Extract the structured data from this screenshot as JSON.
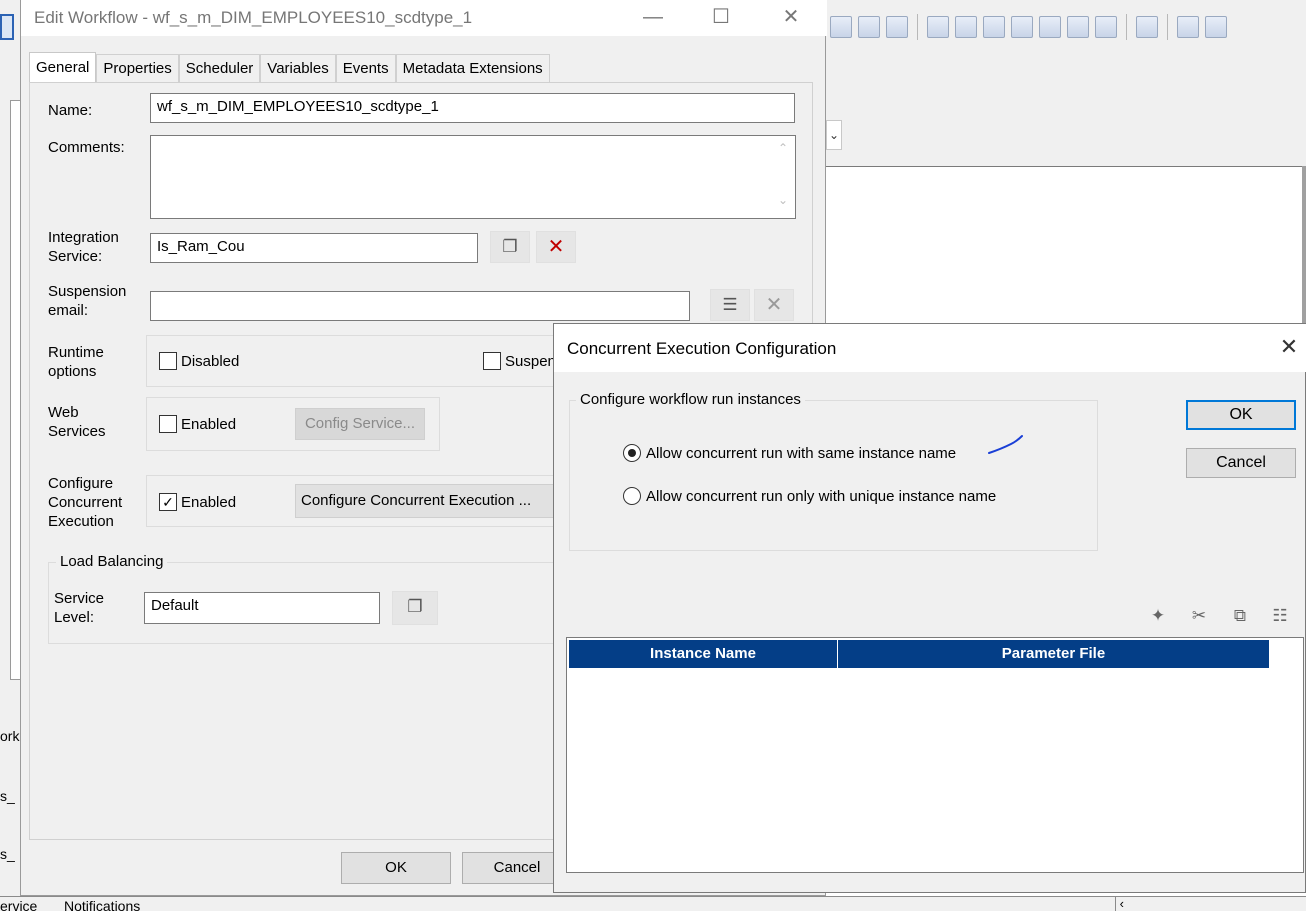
{
  "background": {
    "left_texts": [
      "ork",
      "s_",
      "s_"
    ],
    "bottom_tabs": [
      "ervice",
      "Notifications"
    ]
  },
  "edit_workflow": {
    "title": "Edit Workflow - wf_s_m_DIM_EMPLOYEES10_scdtype_1",
    "tabs": [
      "General",
      "Properties",
      "Scheduler",
      "Variables",
      "Events",
      "Metadata Extensions"
    ],
    "active_tab": "General",
    "name_label": "Name:",
    "name_value": "wf_s_m_DIM_EMPLOYEES10_scdtype_1",
    "comments_label": "Comments:",
    "comments_value": "",
    "integration_label_1": "Integration",
    "integration_label_2": "Service:",
    "integration_value": "Is_Ram_Cou",
    "suspension_label_1": "Suspension",
    "suspension_label_2": "email:",
    "suspension_value": "",
    "runtime_label_1": "Runtime",
    "runtime_label_2": "options",
    "runtime_disabled": "Disabled",
    "runtime_suspend": "Suspen",
    "web_label_1": "Web",
    "web_label_2": "Services",
    "web_enabled": "Enabled",
    "config_service": "Config Service...",
    "concurrent_label_1": "Configure",
    "concurrent_label_2": "Concurrent",
    "concurrent_label_3": "Execution",
    "concurrent_enabled": "Enabled",
    "configure_concurrent_button": "Configure Concurrent Execution ...",
    "load_balancing": "Load Balancing",
    "service_label_1": "Service",
    "service_label_2": "Level:",
    "service_value": "Default",
    "ok": "OK",
    "cancel": "Cancel"
  },
  "concurrent_dialog": {
    "title": "Concurrent Execution Configuration",
    "group_title": "Configure workflow run instances",
    "option_same": "Allow concurrent run with same instance name",
    "option_unique": "Allow concurrent run only with unique instance name",
    "selected": "same",
    "ok": "OK",
    "cancel": "Cancel",
    "columns": [
      "Instance Name",
      "Parameter File"
    ],
    "rows": []
  },
  "colors": {
    "grid_header": "#043e87",
    "default_button_border": "#0078d7",
    "delete_x": "#c00000",
    "annotation": "#1a3fd6"
  }
}
